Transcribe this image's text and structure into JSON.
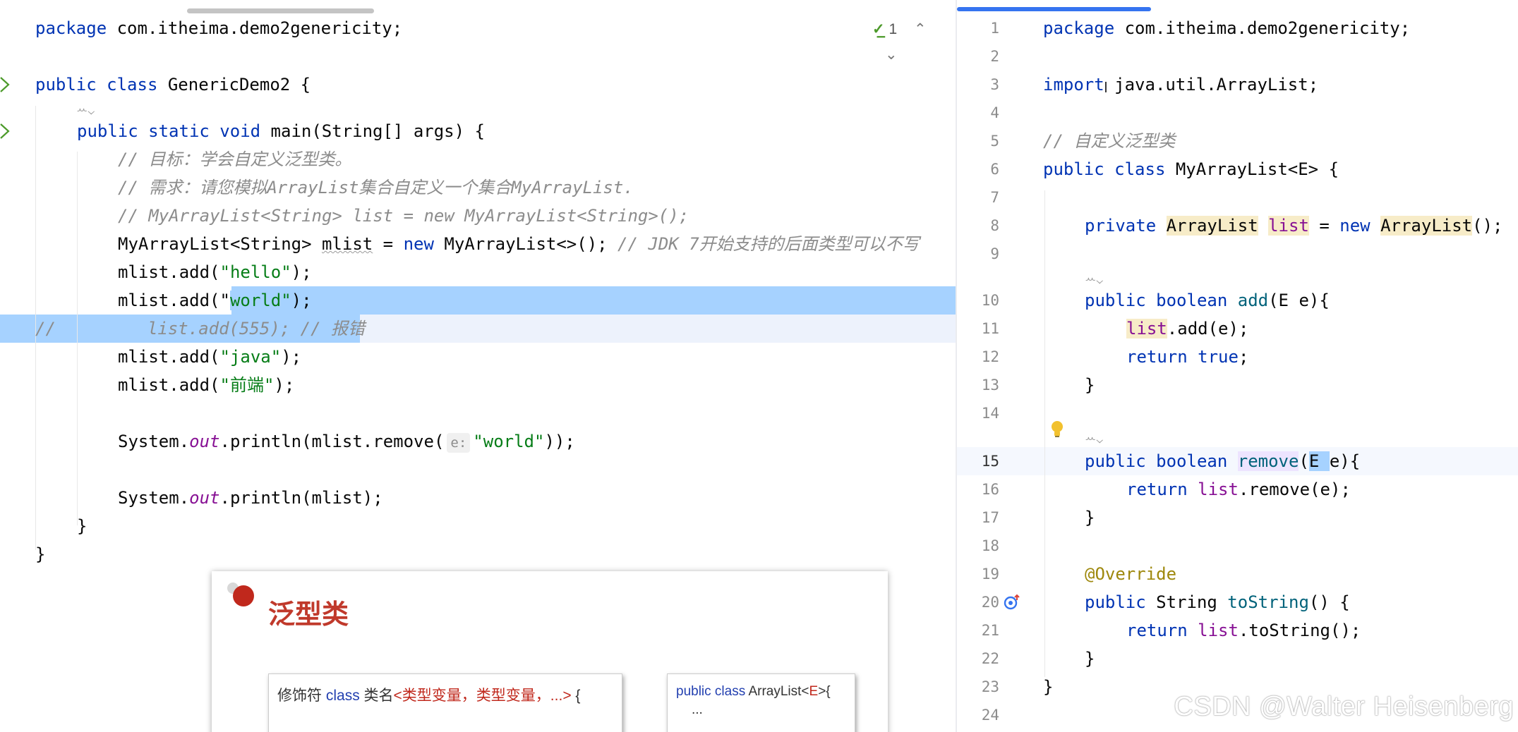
{
  "left_editor": {
    "inspection": {
      "count": "1"
    },
    "lines": {
      "pkg_kw": "package",
      "pkg_name": " com.itheima.demo2genericity;",
      "class_kw": "public class",
      "class_name": " GenericDemo2 {",
      "main_kw": "public static void",
      "main_rest": " main(String[] args) {",
      "c1": "// 目标：学会自定义泛型类。",
      "c2": "// 需求：请您模拟ArrayList集合自定义一个集合MyArrayList.",
      "c3": "// MyArrayList<String> list = new MyArrayList<String>();",
      "decl_a": "MyArrayList<String> ",
      "decl_var": "mlist",
      "decl_b": " = ",
      "decl_new": "new",
      "decl_c": " MyArrayList<>(); ",
      "decl_comment": "// JDK 7开始支持的后面类型可以不写",
      "add1_a": "mlist.add(",
      "add1_s": "\"hello\"",
      "add1_b": ");",
      "add2_a": "mlist.add(\"",
      "add2_s": "world\"",
      "add2_b": ");",
      "commented": "//         list.add(555); // 报错",
      "add3_a": "mlist.add(",
      "add3_s": "\"java\"",
      "add3_b": ");",
      "add4_a": "mlist.add(",
      "add4_s": "\"前端\"",
      "add4_b": ");",
      "p1_a": "System.",
      "p1_out": "out",
      "p1_b": ".println(mlist.remove(",
      "p1_hint": "e:",
      "p1_s": "\"world\"",
      "p1_c": "));",
      "p2_a": "System.",
      "p2_out": "out",
      "p2_b": ".println(mlist);",
      "close1": "}",
      "close2": "}"
    }
  },
  "right_editor": {
    "line_numbers": [
      "1",
      "2",
      "3",
      "4",
      "5",
      "6",
      "7",
      "8",
      "9",
      "10",
      "11",
      "12",
      "13",
      "14",
      "15",
      "16",
      "17",
      "18",
      "19",
      "20",
      "21",
      "22",
      "23",
      "24"
    ],
    "lines": {
      "pkg_kw": "package",
      "pkg_name": " com.itheima.demo2genericity;",
      "imp_kw": "import",
      "imp_name": " java.util.ArrayList;",
      "comment": "// 自定义泛型类",
      "class_kw": "public class",
      "class_name": " MyArrayList<E> {",
      "f_kw": "private",
      "f_type": "ArrayList",
      "f_var": "list",
      "f_eq": " = ",
      "f_new": "new",
      "f_ctor": "ArrayList",
      "f_end": "();",
      "add_kw": "public boolean",
      "add_name": "add",
      "add_rest": "(E e){",
      "add_body_var": "list",
      "add_body_rest": ".add(e);",
      "ret_kw": "return",
      "ret_val": "true",
      "ret_end": ";",
      "close_m1": "}",
      "rem_kw": "public boolean",
      "rem_name": "remove",
      "rem_p": "(",
      "rem_E": "E ",
      "rem_rest": "e){",
      "rem_ret": "return",
      "rem_var": "list",
      "rem_body": ".remove(e);",
      "close_m2": "}",
      "override": "@Override",
      "ts_kw": "public",
      "ts_type": " String ",
      "ts_name": "toString",
      "ts_rest": "() {",
      "ts_ret": "return",
      "ts_var": "list",
      "ts_body": ".toString();",
      "close_m3": "}",
      "close_cls": "}"
    }
  },
  "slide": {
    "title": "泛型类",
    "box1_a": "修饰符 ",
    "box1_kw": "class",
    "box1_b": " 类名",
    "box1_c": "<类型变量，类型变量，...>",
    "box1_d": " {",
    "box2_kw": "public class",
    "box2_b": " ArrayList<",
    "box2_E": "E",
    "box2_c": ">{",
    "box2_dots": "..."
  },
  "watermark": "CSDN @Walter Heisenberg"
}
